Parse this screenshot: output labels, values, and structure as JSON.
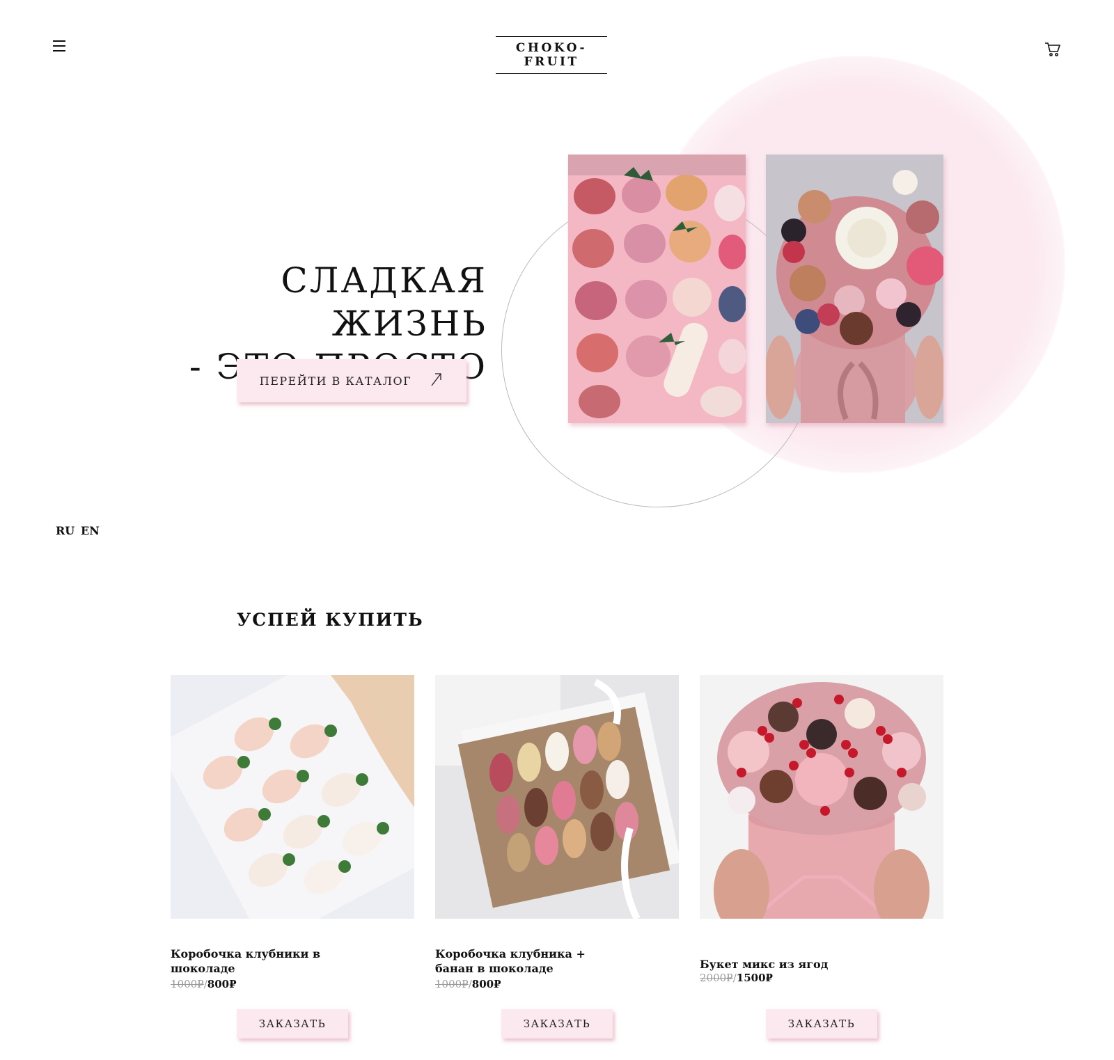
{
  "header": {
    "logo": "CHOKO-FRUIT",
    "menu_icon": "hamburger-menu-icon",
    "cart_icon": "shopping-cart-icon"
  },
  "hero": {
    "title_line1": "СЛАДКАЯ ЖИЗНЬ",
    "title_line2": "- ЭТО ПРОСТО",
    "catalog_button": "ПЕРЕЙТИ В КАТАЛОГ",
    "catalog_button_icon": "arrow-up-right-icon",
    "photos": [
      "chocolate-covered-fruits-box-photo",
      "macaron-berry-bouquet-photo"
    ]
  },
  "languages": [
    "RU",
    "EN"
  ],
  "section": {
    "title": "УСПЕЙ КУПИТЬ"
  },
  "products": [
    {
      "name": "Коробочка клубники в шоколаде",
      "old_price": "1000₽",
      "separator": "/",
      "price": "800₽",
      "button": "ЗАКАЗАТЬ"
    },
    {
      "name": "Коробочка клубника + банан в шоколаде",
      "old_price": "1000₽",
      "separator": "/",
      "price": "800₽",
      "button": "ЗАКАЗАТЬ"
    },
    {
      "name": "Букет микс из ягод",
      "old_price": "2000₽",
      "separator": "/",
      "price": "1500₽",
      "button": "ЗАКАЗАТЬ"
    }
  ],
  "colors": {
    "accent_pink": "#fbe9ef",
    "text": "#111111",
    "muted": "#9a9a9a"
  }
}
